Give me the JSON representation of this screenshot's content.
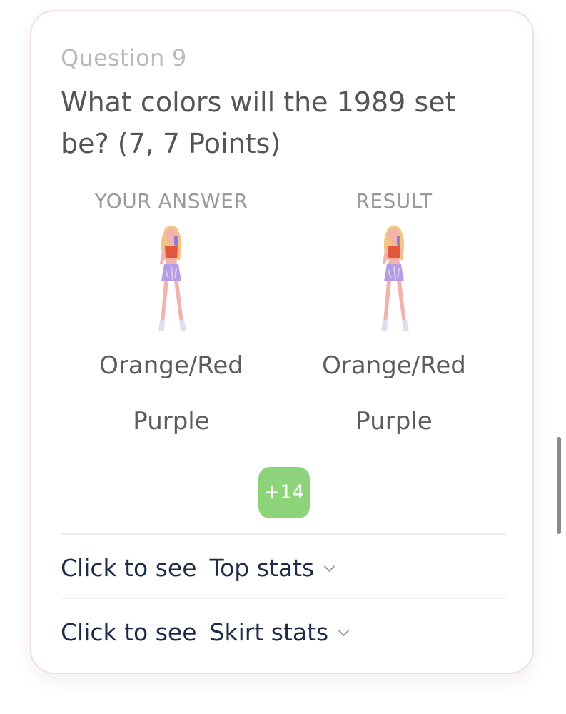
{
  "question": {
    "number_label": "Question 9",
    "text": "What colors will the 1989 set be? (7, 7 Points)"
  },
  "your_answer": {
    "header": "YOUR ANSWER",
    "line1": "Orange/Red",
    "line2": "Purple"
  },
  "result": {
    "header": "RESULT",
    "line1": "Orange/Red",
    "line2": "Purple"
  },
  "points_badge": "+14",
  "stats": [
    {
      "prefix": "Click to see",
      "label": "Top stats"
    },
    {
      "prefix": "Click to see",
      "label": "Skirt stats"
    }
  ],
  "colors": {
    "badge": "#8dd37a",
    "top": "#e2583a",
    "skirt": "#b79ce3",
    "hair": "#f2c583",
    "skin": "#f3b3ad"
  }
}
